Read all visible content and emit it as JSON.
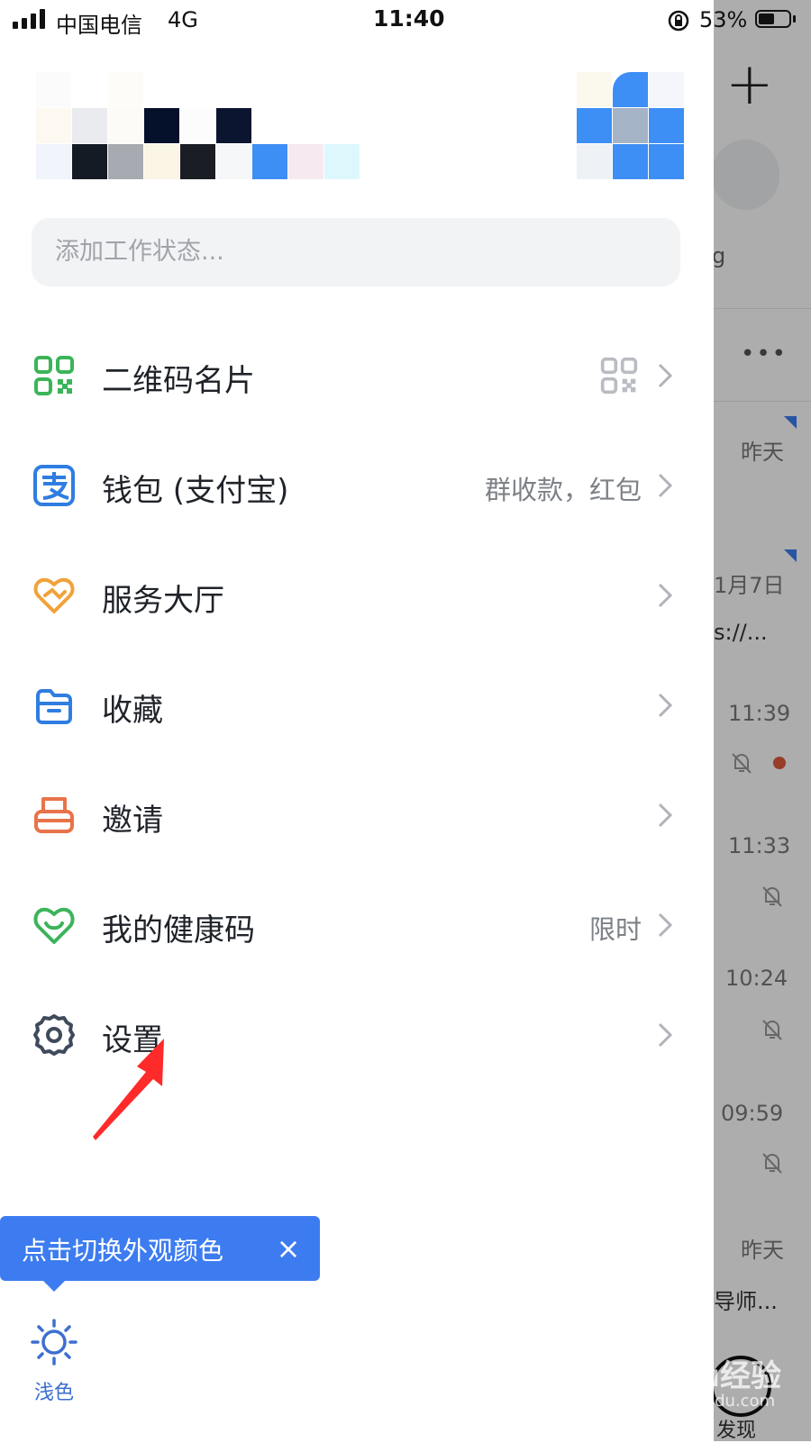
{
  "status_bar": {
    "carrier": "中国电信",
    "network": "4G",
    "time": "11:40",
    "battery": "53%",
    "battery_level": 0.53
  },
  "profile": {
    "status_placeholder": "添加工作状态..."
  },
  "menu": {
    "items": [
      {
        "label": "二维码名片",
        "extra": "",
        "icon": "qr-code-icon"
      },
      {
        "label": "钱包 (支付宝)",
        "extra": "群收款，红包",
        "icon": "alipay-icon"
      },
      {
        "label": "服务大厅",
        "extra": "",
        "icon": "service-hall-icon"
      },
      {
        "label": "收藏",
        "extra": "",
        "icon": "favorites-icon"
      },
      {
        "label": "邀请",
        "extra": "",
        "icon": "invite-icon"
      },
      {
        "label": "我的健康码",
        "extra": "限时",
        "icon": "health-code-icon"
      },
      {
        "label": "设置",
        "extra": "",
        "icon": "settings-icon"
      }
    ]
  },
  "tooltip": {
    "text": "点击切换外观颜色",
    "close": "×"
  },
  "theme_toggle": {
    "label": "浅色"
  },
  "background_chat": {
    "fragment": "g",
    "times": [
      "昨天",
      "1月7日",
      "11:39",
      "11:33",
      "10:24",
      "09:59",
      "昨天"
    ],
    "snippets": [
      "s://...",
      "导师..."
    ],
    "discover_label": "发现"
  },
  "watermark": {
    "main": "Baidu经验",
    "sub": "jingyan.baidu.com"
  },
  "colors": {
    "accent": "#3d7cf0",
    "arrow": "#ff2a2a",
    "qr_green": "#3cb45a",
    "orange": "#f0a23a",
    "invite_orange": "#e8734a",
    "settings_gray": "#3f4a5c"
  }
}
